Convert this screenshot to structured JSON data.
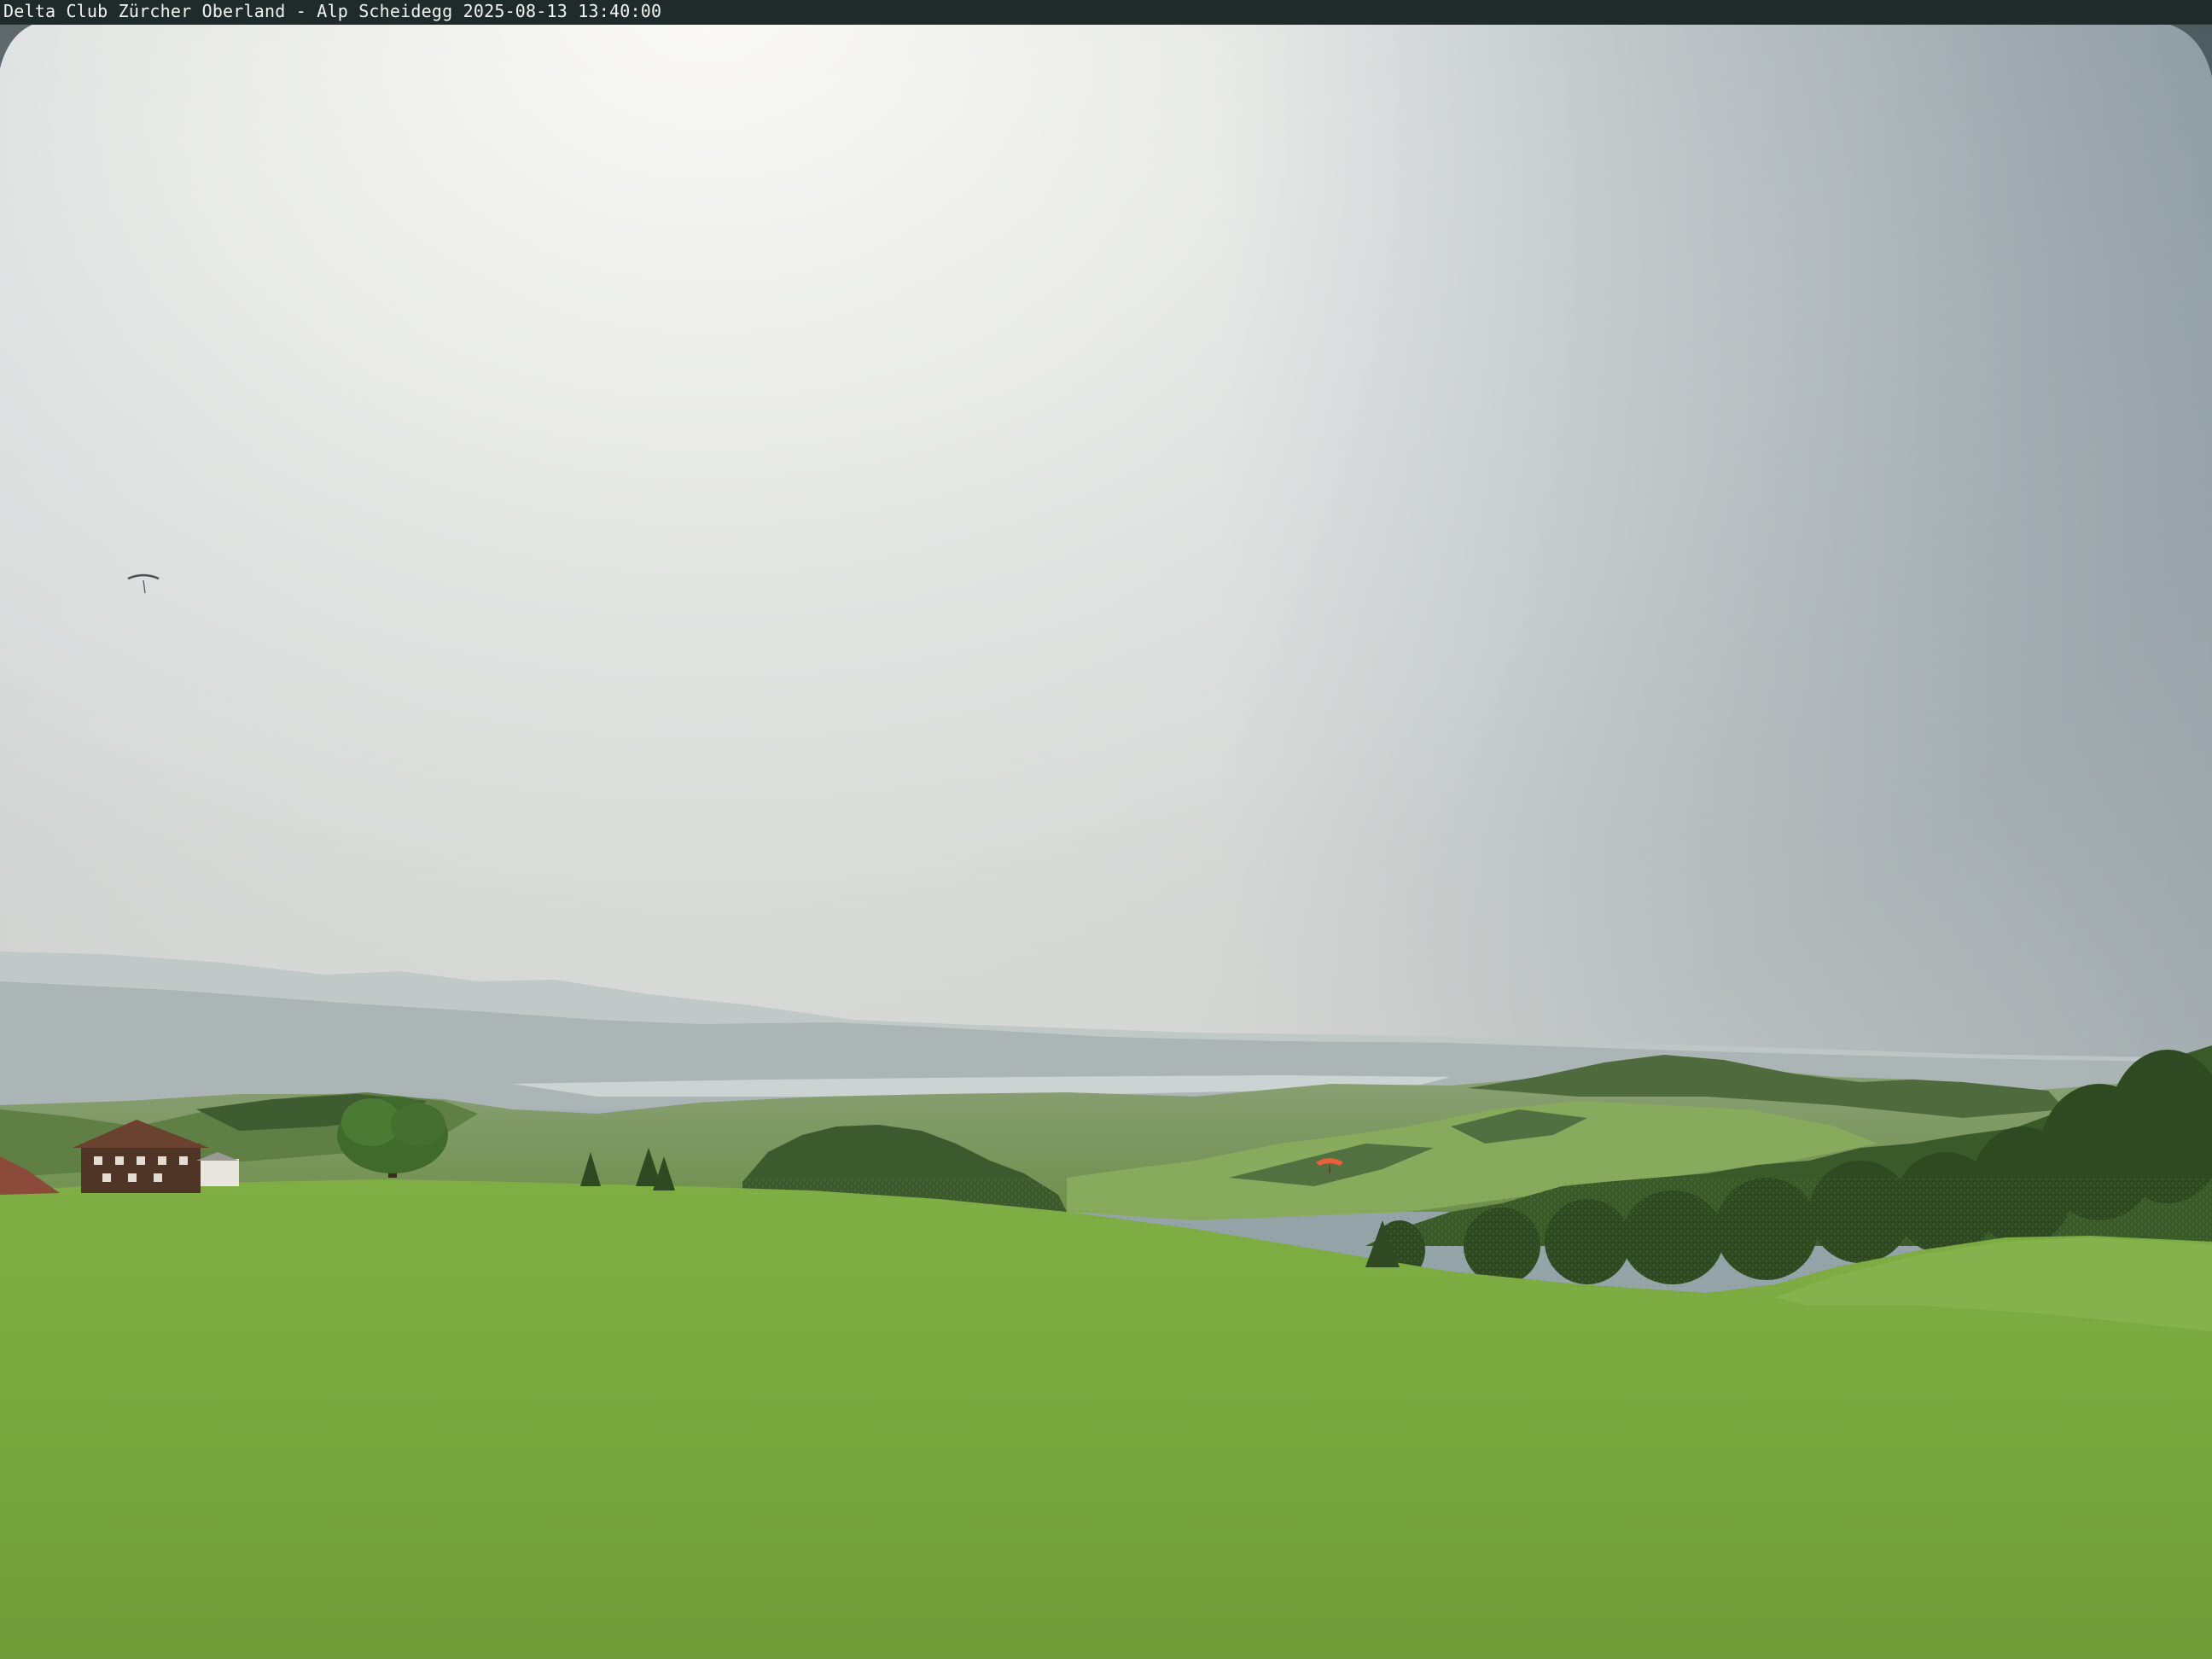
{
  "caption": {
    "text": "Delta Club Zürcher Oberland - Alp Scheidegg 2025-08-13 13:40:00"
  },
  "scene": {
    "description_icons": [
      "sky",
      "distant-mountains",
      "lake",
      "forested-hills",
      "meadow",
      "farmhouse",
      "paraglider-orange",
      "paraglider-distant"
    ],
    "colors": {
      "sky_bright": "#f2f1ec",
      "sky_mid": "#c9d0d2",
      "sky_edge": "#8f9ca3",
      "haze": "#d8dad6",
      "mountains_far": "#b9c1c3",
      "hills_mid": "#6f8a5a",
      "forest": "#3e5a2c",
      "meadow": "#86b24a",
      "meadow_dark": "#6f9c3a",
      "farmhouse": "#5a3a2a",
      "paraglider": "#e8603a"
    }
  }
}
